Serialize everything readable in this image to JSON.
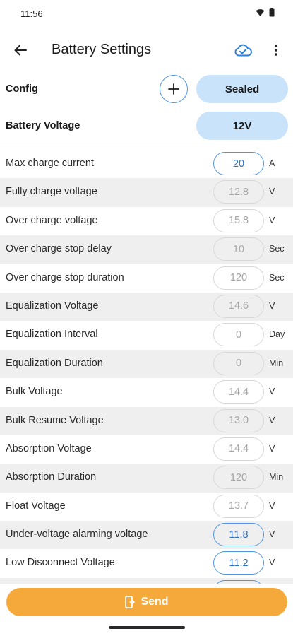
{
  "status": {
    "time": "11:56"
  },
  "app_bar": {
    "title": "Battery Settings"
  },
  "config": {
    "config_label": "Config",
    "config_value": "Sealed",
    "voltage_label": "Battery Voltage",
    "voltage_value": "12V"
  },
  "rows": [
    {
      "label": "Max charge current",
      "value": "20",
      "unit": "A"
    },
    {
      "label": "Fully charge voltage",
      "value": "12.8",
      "unit": "V"
    },
    {
      "label": "Over charge voltage",
      "value": "15.8",
      "unit": "V"
    },
    {
      "label": "Over charge stop delay",
      "value": "10",
      "unit": "Sec"
    },
    {
      "label": "Over charge stop duration",
      "value": "120",
      "unit": "Sec"
    },
    {
      "label": "Equalization Voltage",
      "value": "14.6",
      "unit": "V"
    },
    {
      "label": "Equalization Interval",
      "value": "0",
      "unit": "Day"
    },
    {
      "label": "Equalization Duration",
      "value": "0",
      "unit": "Min"
    },
    {
      "label": "Bulk Voltage",
      "value": "14.4",
      "unit": "V"
    },
    {
      "label": "Bulk Resume Voltage",
      "value": "13.0",
      "unit": "V"
    },
    {
      "label": "Absorption Voltage",
      "value": "14.4",
      "unit": "V"
    },
    {
      "label": "Absorption Duration",
      "value": "120",
      "unit": "Min"
    },
    {
      "label": "Float Voltage",
      "value": "13.7",
      "unit": "V"
    },
    {
      "label": "Under-voltage alarming voltage",
      "value": "11.8",
      "unit": "V"
    },
    {
      "label": "Low Disconnect Voltage",
      "value": "11.2",
      "unit": "V"
    }
  ],
  "send": {
    "label": "Send"
  },
  "colors": {
    "accent": "#4f95e3",
    "pill": "#c9e3fb",
    "send": "#f4a93a"
  }
}
